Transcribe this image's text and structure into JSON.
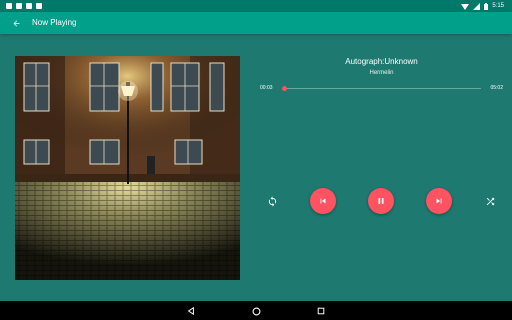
{
  "status_bar": {
    "time": "5:15"
  },
  "app_bar": {
    "title": "Now Playing"
  },
  "track": {
    "title": "Autograph:Unknown",
    "artist": "Hermelin",
    "elapsed": "00:03",
    "duration": "05:02",
    "progress": 0.01
  },
  "colors": {
    "background": "#1e7a70",
    "app_bar": "#00a08a",
    "status_bar": "#00796b",
    "accent": "#ff5361"
  },
  "icons": {
    "back": "arrow-back-icon",
    "repeat": "repeat-icon",
    "previous": "skip-previous-icon",
    "pause": "pause-icon",
    "next": "skip-next-icon",
    "shuffle": "shuffle-icon",
    "nav_back": "triangle-back-icon",
    "nav_home": "circle-home-icon",
    "nav_recents": "square-recents-icon"
  }
}
